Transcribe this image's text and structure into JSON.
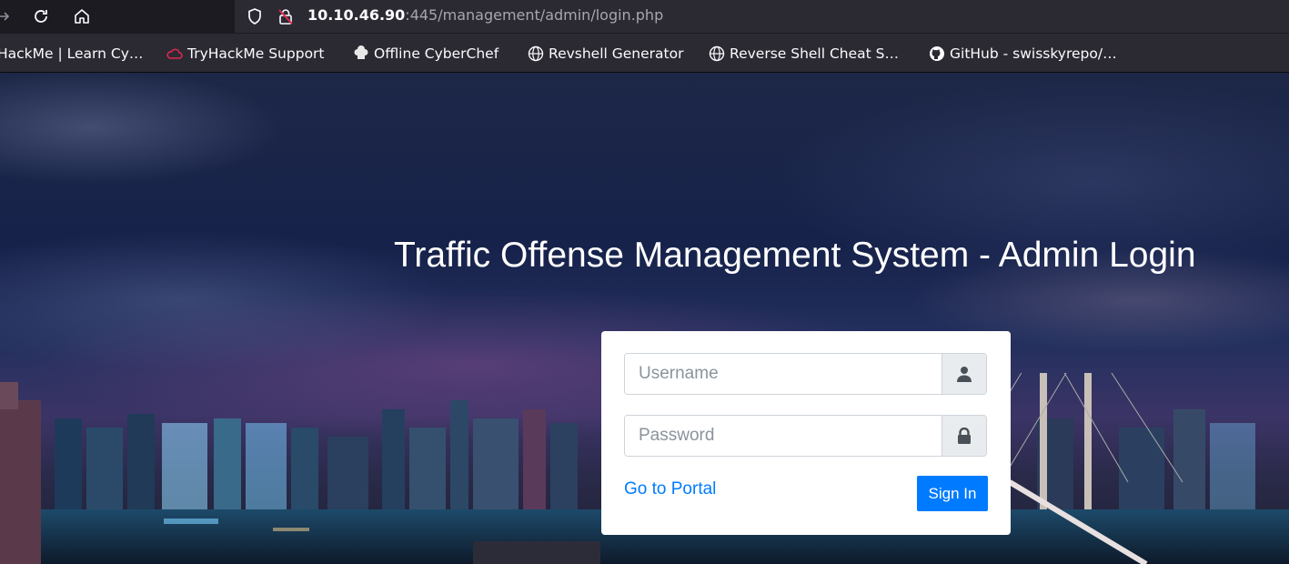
{
  "browser": {
    "url_host": "10.10.46.90",
    "url_rest": ":445/management/admin/login.php",
    "bookmarks": [
      {
        "label": "HackMe | Learn Cy…",
        "icon": "tryhackme-icon"
      },
      {
        "label": "TryHackMe Support",
        "icon": "cloud-icon"
      },
      {
        "label": "Offline CyberChef",
        "icon": "chef-hat-icon"
      },
      {
        "label": "Revshell Generator",
        "icon": "globe-icon"
      },
      {
        "label": "Reverse Shell Cheat S…",
        "icon": "globe-icon"
      },
      {
        "label": "GitHub - swisskyrepo/…",
        "icon": "github-icon"
      }
    ]
  },
  "page": {
    "title": "Traffic Offense Management System - Admin Login",
    "username_placeholder": "Username",
    "password_placeholder": "Password",
    "portal_link": "Go to Portal",
    "signin_label": "Sign In"
  },
  "colors": {
    "accent": "#007bff",
    "browser_toolbar": "#2b2a33",
    "browser_frame": "#1c1b22",
    "insecure_icon": "#e22850"
  }
}
